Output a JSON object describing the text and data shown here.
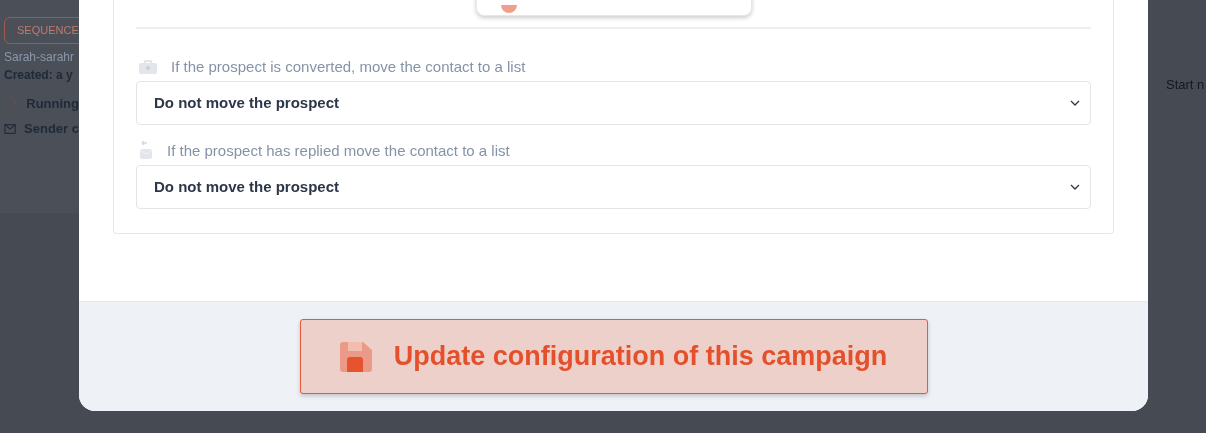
{
  "background_page": {
    "badge": "SEQUENCE",
    "owner": "Sarah-sarahr",
    "created": "Created: a y",
    "status": "Running",
    "sender": "Sender c",
    "right_label": "Start n"
  },
  "modal": {
    "move_rules": [
      {
        "kind": "converted",
        "label": "If the prospect is converted, move the contact to a list",
        "value": "Do not move the prospect"
      },
      {
        "kind": "replied",
        "label": "If the prospect has replied move the contact to a list",
        "value": "Do not move the prospect"
      }
    ],
    "submit_button": "Update configuration of this campaign"
  }
}
